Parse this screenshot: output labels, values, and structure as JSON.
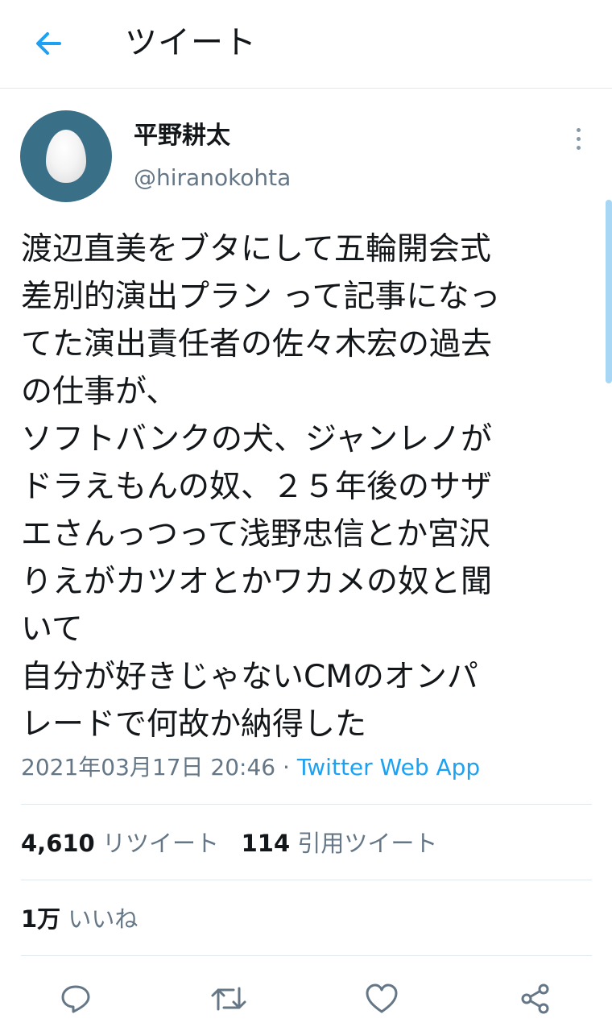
{
  "header": {
    "title": "ツイート",
    "back_icon": "arrow-left-icon"
  },
  "accent_color": "#1da1f2",
  "tweet": {
    "display_name": "平野耕太",
    "username": "@hiranokohta",
    "text": "渡辺直美をブタにして五輪開会式\n差別的演出プラン って記事になっ\nてた演出責任者の佐々木宏の過去\nの仕事が、\nソフトバンクの犬、ジャンレノが\nドラえもんの奴、２５年後のサザ\nエさんっつって浅野忠信とか宮沢\nりえがカツオとかワカメの奴と聞\nいて\n自分が好きじゃないCMのオンパ\nレードで何故か納得した",
    "timestamp": "2021年03月17日 20:46",
    "separator": " · ",
    "source": "Twitter Web App"
  },
  "stats": {
    "retweets_count": "4,610",
    "retweets_label": "リツイート",
    "quotes_count": "114",
    "quotes_label": "引用ツイート",
    "likes_count": "1万",
    "likes_label": "いいね"
  },
  "actions": [
    "reply-icon",
    "retweet-icon",
    "like-icon",
    "share-icon"
  ]
}
